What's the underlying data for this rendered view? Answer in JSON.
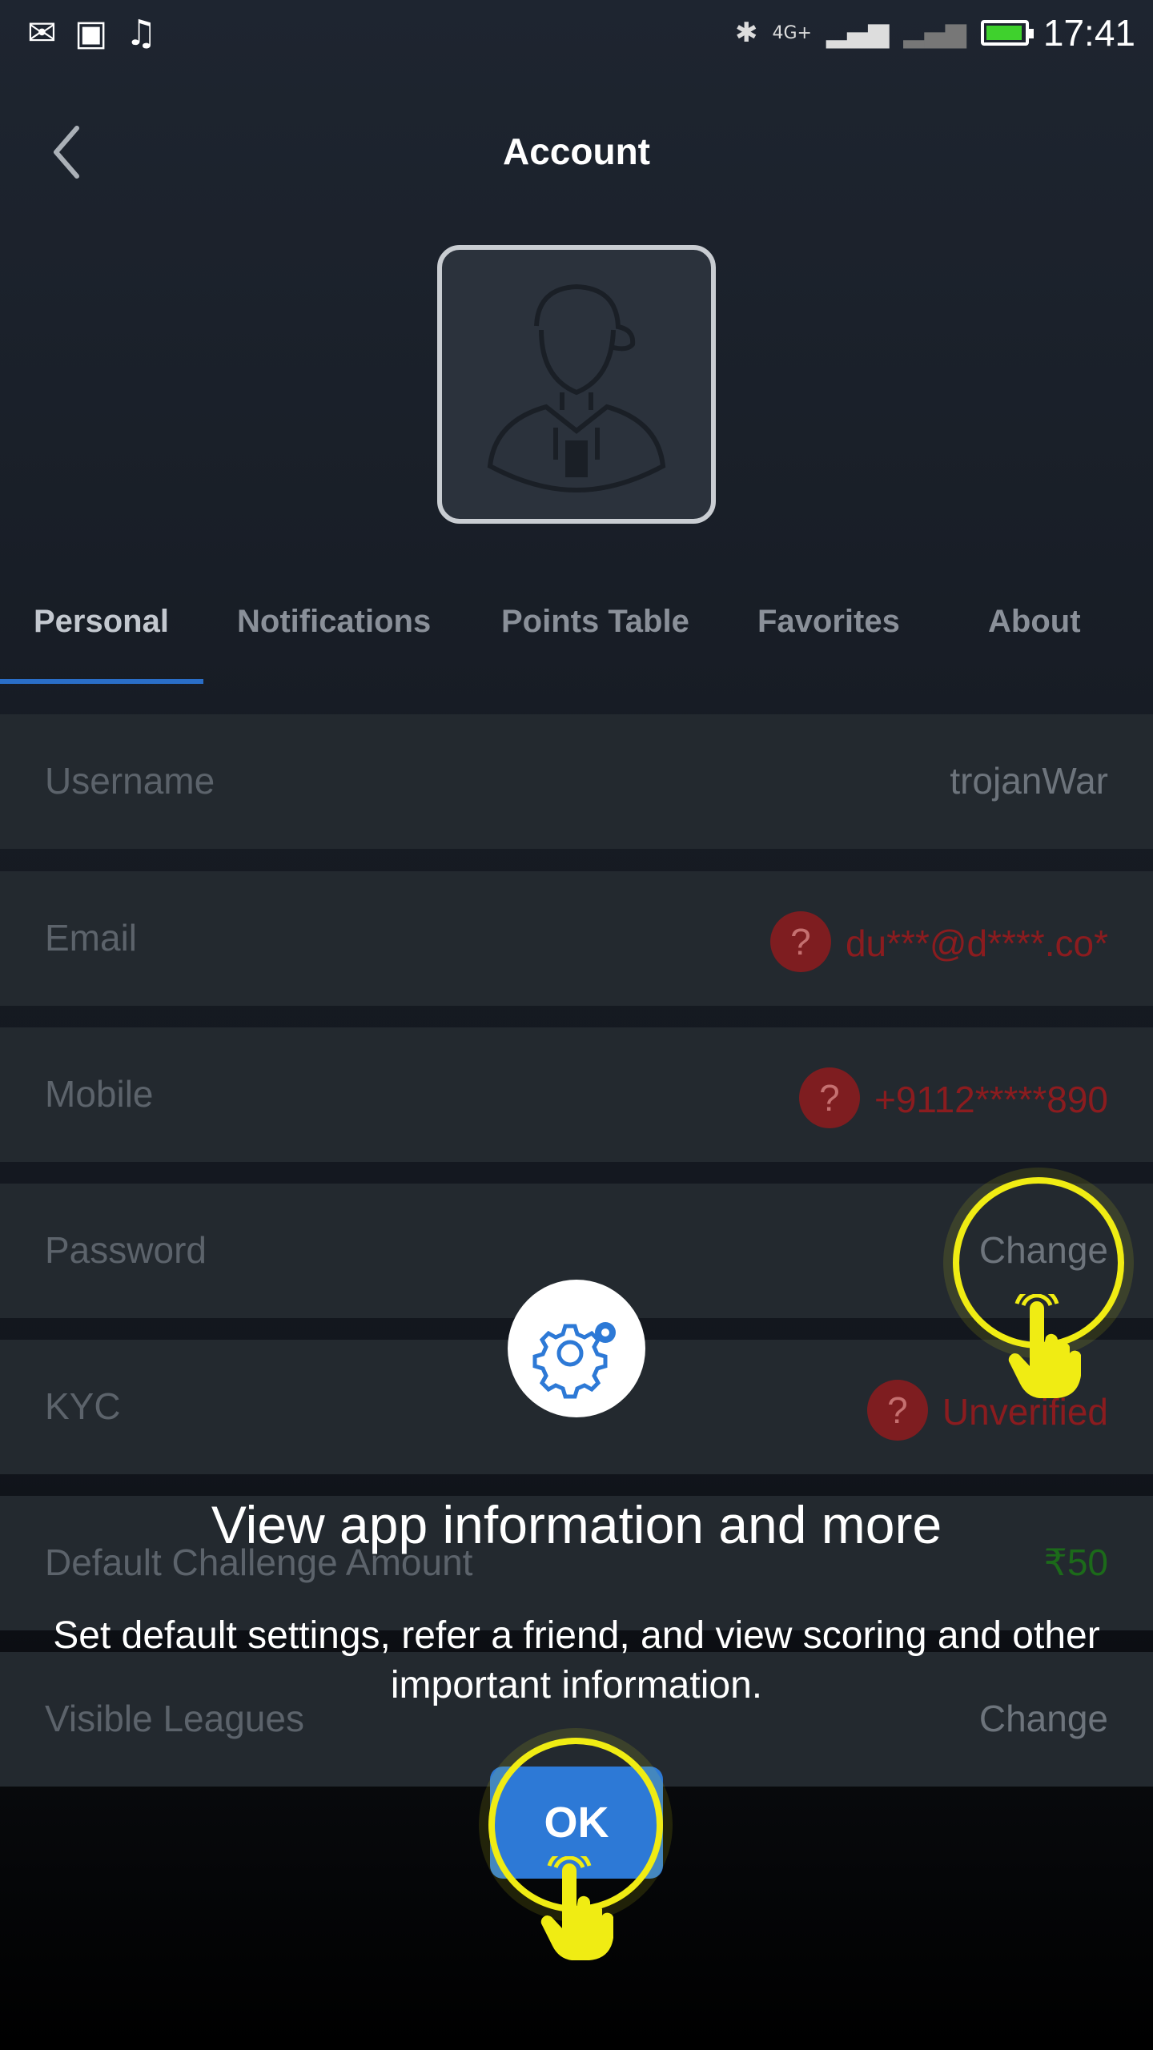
{
  "status_bar": {
    "time": "17:41",
    "network": "4G+",
    "left_icons": [
      "gmail-icon",
      "image-icon",
      "music-icon"
    ],
    "battery_color": "#3fd12d"
  },
  "header": {
    "title": "Account"
  },
  "tabs": [
    {
      "label": "Personal",
      "active": true
    },
    {
      "label": "Notifications",
      "active": false
    },
    {
      "label": "Points Table",
      "active": false
    },
    {
      "label": "Favorites",
      "active": false
    },
    {
      "label": "About",
      "active": false
    }
  ],
  "personal": {
    "rows": [
      {
        "label": "Username",
        "value": "trojanWar"
      },
      {
        "label": "Email",
        "value": "du***@d****.co*",
        "status_icon": "question-badge-icon"
      },
      {
        "label": "Mobile",
        "value": "+9112*****890",
        "status_icon": "question-badge-icon"
      },
      {
        "label": "Password",
        "value": "Change"
      },
      {
        "label": "KYC",
        "value": "Unverified",
        "status_icon": "question-badge-icon"
      },
      {
        "label": "Default Challenge Amount",
        "value": "₹50"
      },
      {
        "label": "Visible Leagues",
        "value": "Change"
      }
    ]
  },
  "tutorial": {
    "icon": "gear-icon",
    "title": "View app information and more",
    "body": "Set default settings, refer a friend, and view scoring and other important information.",
    "ok_label": "OK"
  },
  "colors": {
    "accent": "#2a6ec7",
    "ok_button": "#2d79d6",
    "highlight_ring": "#f0ec13",
    "error_red": "#8b1c1f",
    "success_green": "#1c6a1a"
  }
}
